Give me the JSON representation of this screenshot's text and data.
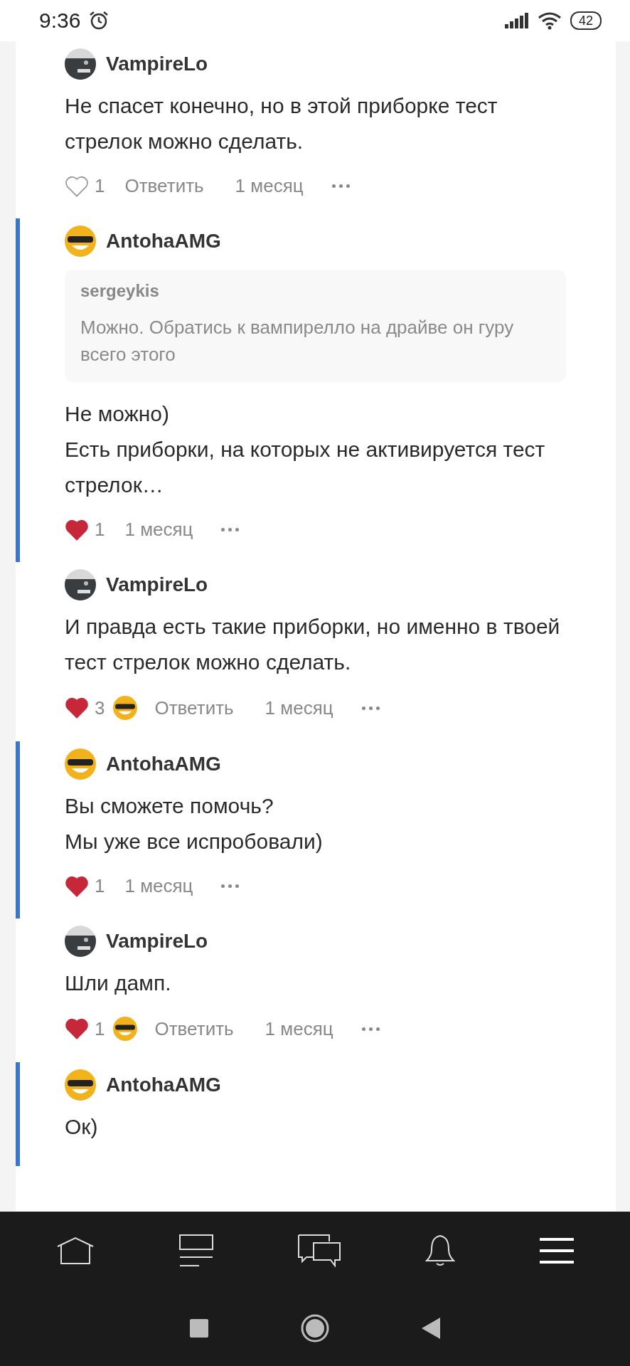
{
  "status_bar": {
    "time": "9:36",
    "battery": "42"
  },
  "comments": [
    {
      "author": "VampireLo",
      "kind": "car",
      "highlighted": false,
      "paragraphs": [
        "Не спасет конечно, но в этой приборке тест стрелок можно сделать."
      ],
      "likes": "1",
      "liked": false,
      "liker_avatar": false,
      "reply": "Ответить",
      "time": "1 месяц"
    },
    {
      "author": "AntohaAMG",
      "kind": "smiley",
      "highlighted": true,
      "quote": {
        "author": "sergeykis",
        "text": "Можно. Обратись к вампирелло на драйве он гуру всего этого"
      },
      "paragraphs": [
        "Не можно)",
        "Есть приборки, на которых не активируется тест стрелок…"
      ],
      "likes": "1",
      "liked": true,
      "liker_avatar": false,
      "time": "1 месяц"
    },
    {
      "author": "VampireLo",
      "kind": "car",
      "highlighted": false,
      "paragraphs": [
        "И правда есть такие приборки, но именно в твоей тест стрелок можно сделать."
      ],
      "likes": "3",
      "liked": true,
      "liker_avatar": true,
      "reply": "Ответить",
      "time": "1 месяц"
    },
    {
      "author": "AntohaAMG",
      "kind": "smiley",
      "highlighted": true,
      "paragraphs": [
        "Вы сможете помочь?",
        "Мы уже все испробовали)"
      ],
      "likes": "1",
      "liked": true,
      "liker_avatar": false,
      "time": "1 месяц"
    },
    {
      "author": "VampireLo",
      "kind": "car",
      "highlighted": false,
      "paragraphs": [
        "Шли дамп."
      ],
      "likes": "1",
      "liked": true,
      "liker_avatar": true,
      "reply": "Ответить",
      "time": "1 месяц"
    },
    {
      "author": "AntohaAMG",
      "kind": "smiley",
      "highlighted": true,
      "paragraphs": [
        "Ок)"
      ]
    }
  ],
  "bottom_nav": [
    {
      "kind": "home"
    },
    {
      "kind": "feed"
    },
    {
      "kind": "messages"
    },
    {
      "kind": "bell"
    },
    {
      "kind": "menu"
    }
  ],
  "system_nav": [
    {
      "kind": "square"
    },
    {
      "kind": "circle"
    },
    {
      "kind": "back"
    }
  ]
}
